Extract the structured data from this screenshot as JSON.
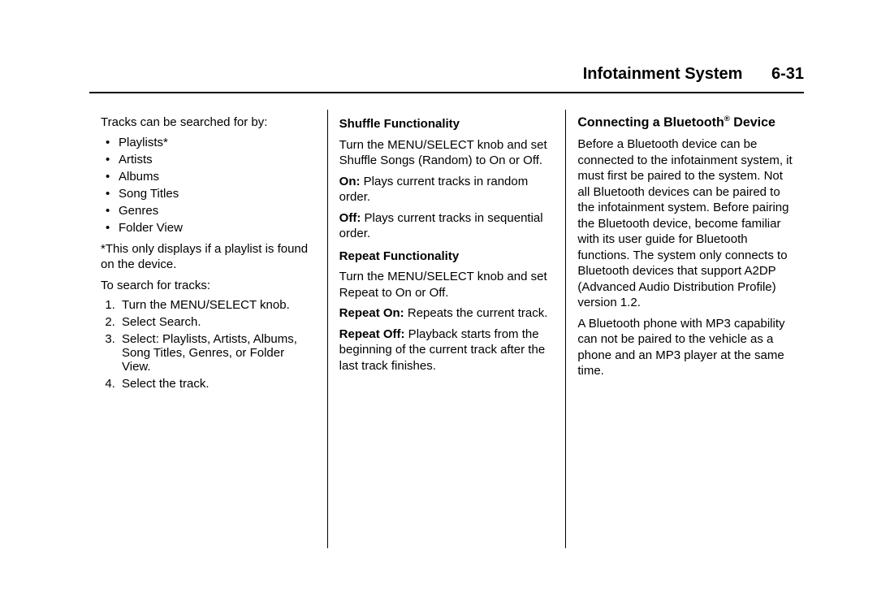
{
  "header": {
    "title": "Infotainment System",
    "page": "6-31"
  },
  "col1": {
    "intro": "Tracks can be searched for by:",
    "bullets": [
      "Playlists*",
      "Artists",
      "Albums",
      "Song Titles",
      "Genres",
      "Folder View"
    ],
    "note": "*This only displays if a playlist is found on the device.",
    "search_intro": "To search for tracks:",
    "steps": [
      "Turn the MENU/SELECT knob.",
      "Select Search.",
      "Select: Playlists, Artists, Albums, Song Titles, Genres, or Folder View.",
      "Select the track."
    ]
  },
  "col2": {
    "shuffle_head": "Shuffle Functionality",
    "shuffle_p1": "Turn the MENU/SELECT knob and set Shuffle Songs (Random) to On or Off.",
    "on_label": "On:",
    "on_text": "  Plays current tracks in random order.",
    "off_label": "Off:",
    "off_text": "  Plays current tracks in sequential order.",
    "repeat_head": "Repeat Functionality",
    "repeat_p1": "Turn the MENU/SELECT knob and set Repeat to On or Off.",
    "ron_label": "Repeat On:",
    "ron_text": "  Repeats the current track.",
    "roff_label": "Repeat Off:",
    "roff_text": "  Playback starts from the beginning of the current track after the last track finishes."
  },
  "col3": {
    "head_pre": "Connecting a Bluetooth",
    "head_sup": "®",
    "head_post": " Device",
    "p1": "Before a Bluetooth device can be connected to the infotainment system, it must first be paired to the system. Not all Bluetooth devices can be paired to the infotainment system. Before pairing the Bluetooth device, become familiar with its user guide for Bluetooth functions. The system only connects to Bluetooth devices that support A2DP (Advanced Audio Distribution Profile) version 1.2.",
    "p2": "A Bluetooth phone with MP3 capability can not be paired to the vehicle as a phone and an MP3 player at the same time."
  }
}
